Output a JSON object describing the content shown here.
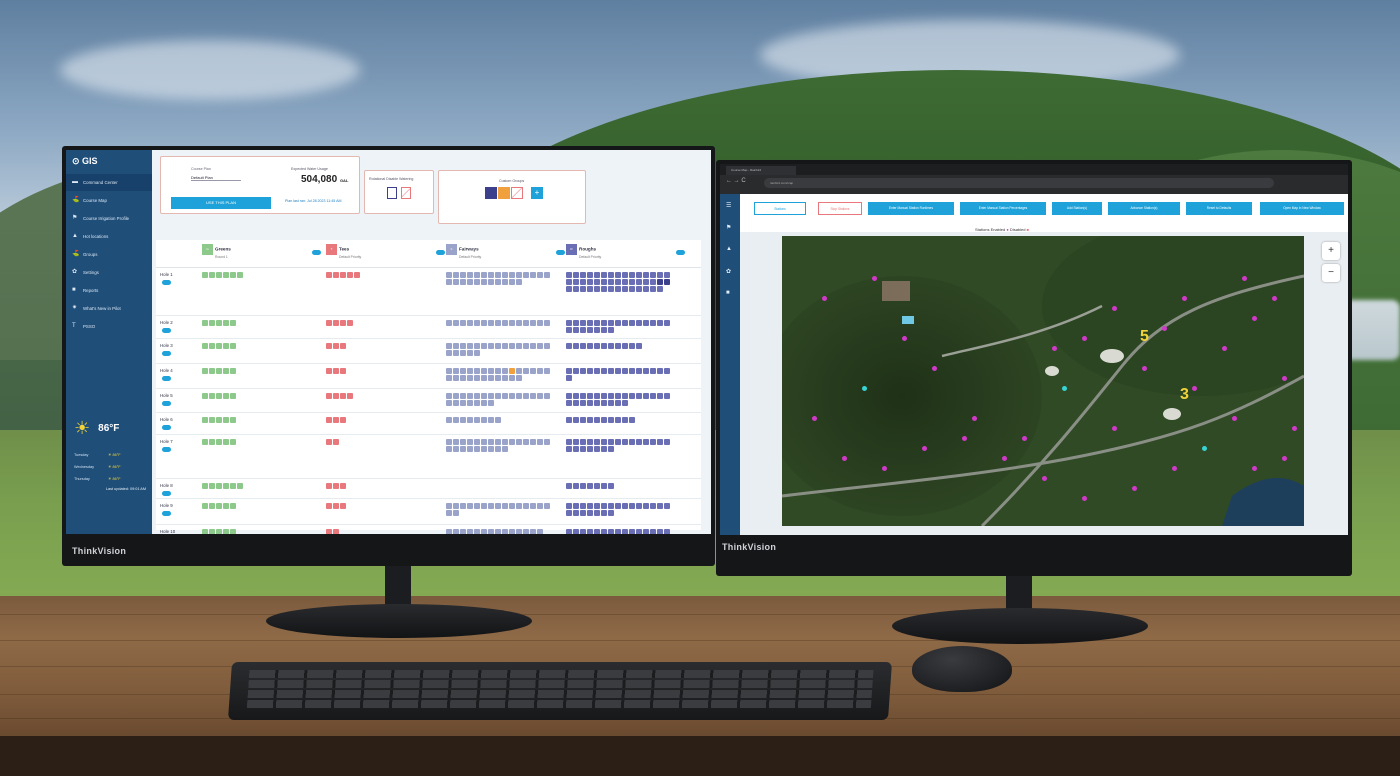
{
  "left_app": {
    "title": "GIS",
    "nav": [
      {
        "icon": "▬",
        "label": "Command Center"
      },
      {
        "icon": "⛳",
        "label": "Course Map"
      },
      {
        "icon": "⚑",
        "label": "Course Irrigation Profile"
      },
      {
        "icon": "▲",
        "label": "Hot locations"
      },
      {
        "icon": "⛳",
        "label": "Groups"
      },
      {
        "icon": "✿",
        "label": "Settings"
      },
      {
        "icon": "■",
        "label": "Reports"
      },
      {
        "icon": "✷",
        "label": "What's New in Pilot"
      },
      {
        "icon": "T",
        "label": "PSSO"
      }
    ],
    "weather": {
      "temp": "86°F",
      "days": [
        {
          "day": "Tuesday",
          "hi": "86°F"
        },
        {
          "day": "Wednesday",
          "hi": "86°F"
        },
        {
          "day": "Thursday",
          "hi": "86°F"
        }
      ],
      "updated": "Last updated: 09:01 AM"
    },
    "plan": {
      "label": "Course Plan",
      "value": "Default Plan",
      "button": "USE THIS PLAN",
      "water_label": "Expected Water Usage",
      "water_value": "504,080",
      "water_unit": "GAL",
      "plan_last": "Plan last ran: Jul 28 2023 11:45 AM"
    },
    "rotation_label": "Rotational Disable Watering",
    "sensor_label": "Custom Groups",
    "columns": [
      {
        "code": "G",
        "name": "Greens",
        "sub": "Round 1"
      },
      {
        "code": "T",
        "name": "Tees",
        "sub": "Default Priority"
      },
      {
        "code": "F",
        "name": "Fairways",
        "sub": "Default Priority"
      },
      {
        "code": "R",
        "name": "Roughs",
        "sub": "Default Priority"
      }
    ],
    "holes": [
      "Hole 1",
      "Hole 2",
      "Hole 3",
      "Hole 4",
      "Hole 5",
      "Hole 6",
      "Hole 7",
      "Hole 8",
      "Hole 9",
      "Hole 10"
    ],
    "colors": {
      "sidebar": "#1f4e79",
      "accent": "#1ea2d9",
      "greens": "#8cc98b",
      "tees": "#e8787c",
      "fairways": "#9aa3c9",
      "roughs": "#6a6fb5"
    }
  },
  "right_app": {
    "tab_title": "Course Map - Rainbird",
    "url": "rainbird.com/map",
    "buttons": [
      "Stations",
      "Stop Stations",
      "Enter Manual Station Runtimes",
      "Enter Manual Station Percentages",
      "Add Station(s)",
      "Advance Station(s)",
      "Reset to Defaults",
      "Open Map in New Window"
    ],
    "legend": {
      "label1": "Stations Enabled",
      "label2": "Disabled"
    },
    "zoom_in": "+",
    "zoom_out": "−",
    "hole_labels": [
      "5",
      "3"
    ]
  },
  "brand": "ThinkVision"
}
